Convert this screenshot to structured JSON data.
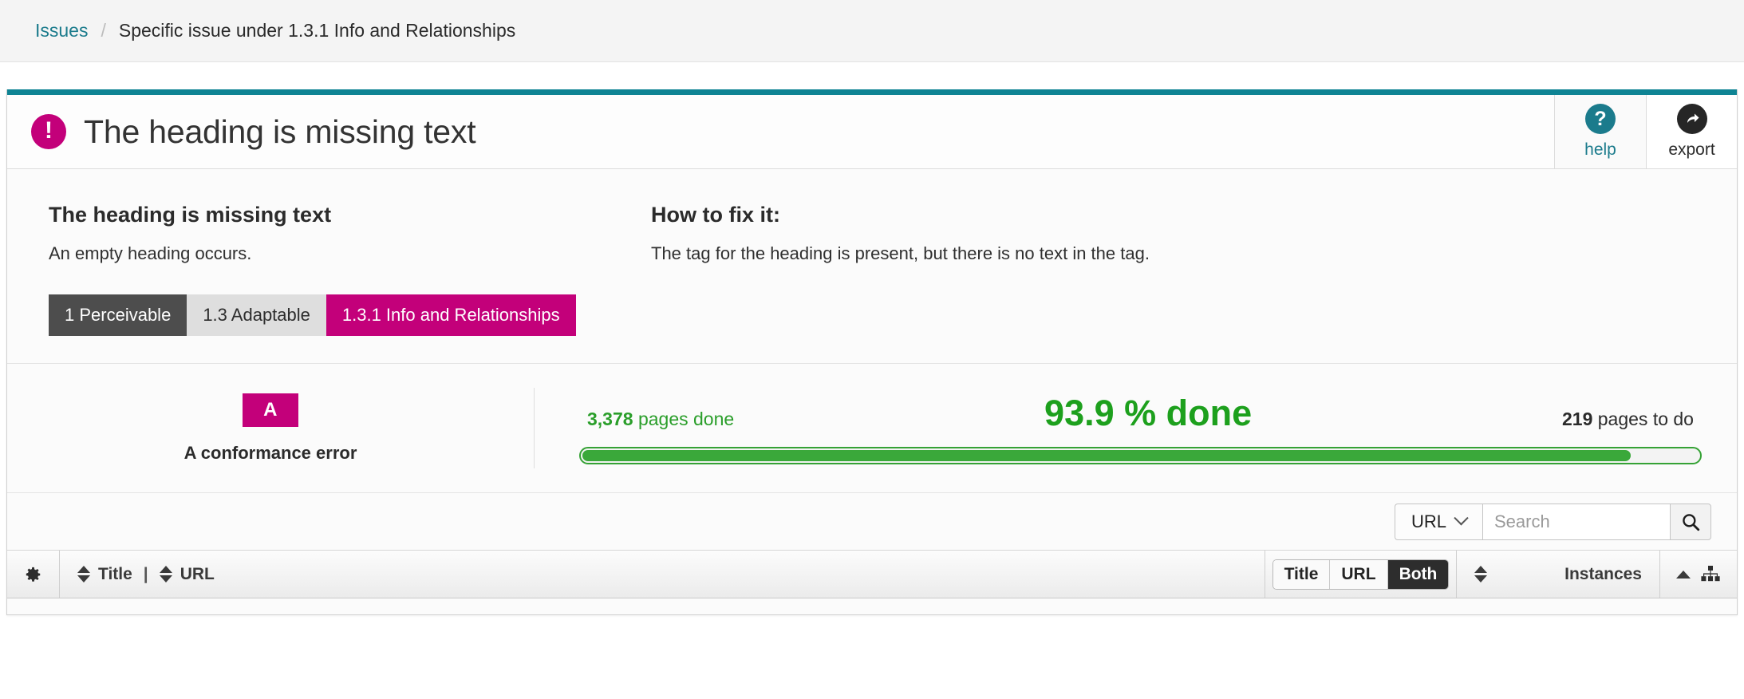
{
  "breadcrumb": {
    "root_label": "Issues",
    "separator": "/",
    "current_label": "Specific issue under 1.3.1 Info and Relationships"
  },
  "header": {
    "title": "The heading is missing text",
    "error_icon_glyph": "!",
    "help": {
      "label": "help",
      "icon": "question-mark-circle-icon",
      "glyph": "?"
    },
    "export": {
      "label": "export",
      "icon": "share-arrow-circle-icon",
      "glyph": "➦"
    }
  },
  "description": {
    "left_heading": "The heading is missing text",
    "left_body": "An empty heading occurs.",
    "right_heading": "How to fix it:",
    "right_body": "The tag for the heading is present, but there is no text in the tag."
  },
  "chips": [
    {
      "label": "1 Perceivable",
      "style": "dark"
    },
    {
      "label": "1.3 Adaptable",
      "style": "light"
    },
    {
      "label": "1.3.1 Info and Relationships",
      "style": "magenta"
    }
  ],
  "conformance": {
    "badge": "A",
    "label": "A conformance error"
  },
  "progress": {
    "pages_done_value": "3,378",
    "pages_done_label": "pages done",
    "percent_text": "93.9 % done",
    "percent_value": 93.9,
    "pages_todo_value": "219",
    "pages_todo_label": "pages to do"
  },
  "search": {
    "scope_label": "URL",
    "placeholder": "Search",
    "value": "",
    "submit_icon": "search-icon"
  },
  "table": {
    "settings_icon": "gear-icon",
    "title_col": "Title",
    "col_separator": "|",
    "url_col": "URL",
    "toggle": [
      {
        "label": "Title",
        "active": false
      },
      {
        "label": "URL",
        "active": false
      },
      {
        "label": "Both",
        "active": true
      }
    ],
    "instances_col": "Instances",
    "tree_icon": "sitemap-icon"
  },
  "colors": {
    "accent_teal": "#0f8494",
    "magenta": "#c3007a",
    "green": "#2a9e2a",
    "dark_chip": "#4d4d4d"
  }
}
